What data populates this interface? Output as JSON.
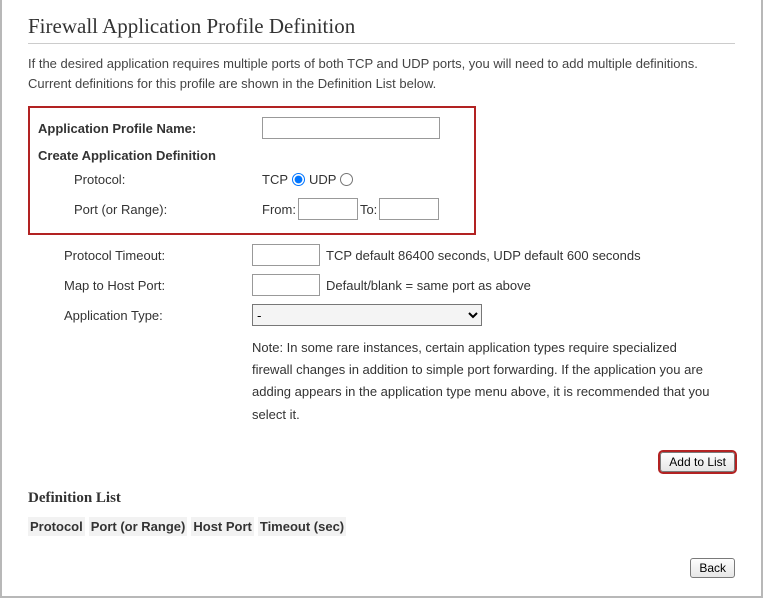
{
  "title": "Firewall Application Profile Definition",
  "intro": "If the desired application requires multiple ports of both TCP and UDP ports, you will need to add multiple definitions. Current definitions for this profile are shown in the Definition List below.",
  "form": {
    "profile_name_label": "Application Profile Name:",
    "profile_name_value": "",
    "create_def_heading": "Create Application Definition",
    "protocol_label": "Protocol:",
    "protocol_tcp": "TCP",
    "protocol_udp": "UDP",
    "port_label": "Port (or Range):",
    "from_label": "From:",
    "from_value": "",
    "to_label": "To:",
    "to_value": "",
    "timeout_label": "Protocol Timeout:",
    "timeout_value": "",
    "timeout_hint": "TCP default 86400 seconds, UDP default 600 seconds",
    "hostport_label": "Map to Host Port:",
    "hostport_value": "",
    "hostport_hint": "Default/blank = same port as above",
    "apptype_label": "Application Type:",
    "apptype_value": "-",
    "apptype_note": "Note: In some rare instances, certain application types require specialized firewall changes in addition to simple port forwarding. If the application you are adding appears in the application type menu above, it is recommended that you select it."
  },
  "buttons": {
    "add_to_list": "Add to List",
    "back": "Back"
  },
  "definition_list": {
    "heading": "Definition List",
    "col_protocol": "Protocol",
    "col_port": "Port (or Range)",
    "col_hostport": "Host Port",
    "col_timeout": "Timeout (sec)"
  }
}
